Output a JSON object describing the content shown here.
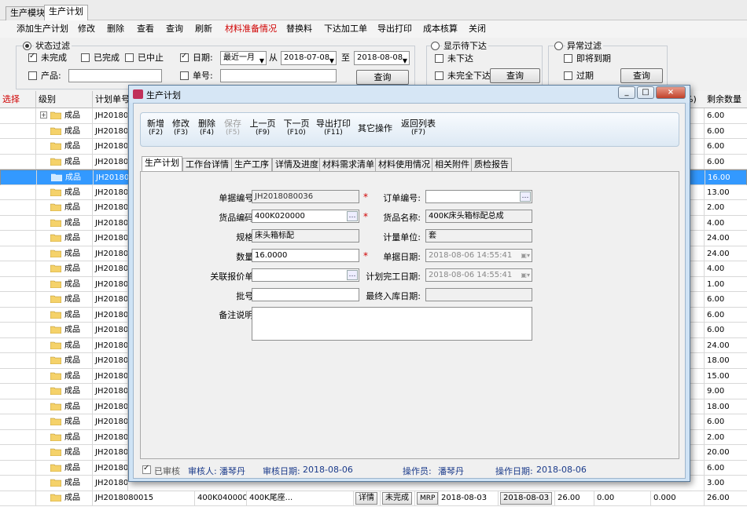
{
  "tabs": [
    "生产模块",
    "生产计划"
  ],
  "toolbar": [
    "添加生产计划",
    "修改",
    "删除",
    "查看",
    "查询",
    "刷新",
    "材料准备情况",
    "替换料",
    "下达加工单",
    "导出打印",
    "成本核算",
    "关闭"
  ],
  "filter": {
    "status_label": "状态过滤",
    "incomplete": "未完成",
    "complete": "已完成",
    "stopped": "已中止",
    "date_label": "日期:",
    "date_range": "最近一月",
    "from": "从",
    "date_from": "2018-07-08",
    "to": "至",
    "date_to": "2018-08-08",
    "product_label": "产品:",
    "doc_label": "单号:",
    "query": "查询",
    "show_pending": "显示待下达",
    "not_issued": "未下达",
    "partial_issued": "未完全下达",
    "abnormal": "异常过滤",
    "due_soon": "即将到期",
    "overdue": "过期"
  },
  "grid": {
    "headers": [
      "选择",
      "级别",
      "计划单号",
      "",
      "剩余数量"
    ],
    "percent_suffix": "%)",
    "category": "成品",
    "rows": [
      {
        "id": "JH201808",
        "rem": "6.00"
      },
      {
        "id": "JH201808",
        "rem": "6.00"
      },
      {
        "id": "JH201808",
        "rem": "6.00"
      },
      {
        "id": "JH201808",
        "rem": "6.00"
      },
      {
        "id": "JH201808",
        "rem": "16.00"
      },
      {
        "id": "JH201808",
        "rem": "13.00"
      },
      {
        "id": "JH201808",
        "rem": "2.00"
      },
      {
        "id": "JH201808",
        "rem": "4.00"
      },
      {
        "id": "JH201808",
        "rem": "24.00"
      },
      {
        "id": "JH201808",
        "rem": "24.00"
      },
      {
        "id": "JH201808",
        "rem": "4.00"
      },
      {
        "id": "JH201808",
        "rem": "1.00"
      },
      {
        "id": "JH201808",
        "rem": "6.00"
      },
      {
        "id": "JH201808",
        "rem": "6.00"
      },
      {
        "id": "JH201808",
        "rem": "6.00"
      },
      {
        "id": "JH201808",
        "rem": "24.00"
      },
      {
        "id": "JH201808",
        "rem": "18.00"
      },
      {
        "id": "JH201808",
        "rem": "15.00"
      },
      {
        "id": "JH201808",
        "rem": "9.00"
      },
      {
        "id": "JH201808",
        "rem": "18.00"
      },
      {
        "id": "JH201808",
        "rem": "6.00"
      },
      {
        "id": "JH201808",
        "rem": "2.00"
      },
      {
        "id": "JH201808",
        "rem": "20.00"
      },
      {
        "id": "JH201808",
        "rem": "6.00"
      },
      {
        "id": "JH201808",
        "rem": "3.00"
      }
    ],
    "last_row": {
      "id": "JH2018080015",
      "code": "400K040000",
      "name": "400K尾座...",
      "detail": "详情",
      "status": "未完成",
      "mrp": "MRP",
      "date1": "2018-08-03",
      "date2": "2018-08-03",
      "qty": "26.00",
      "v1": "0.00",
      "v2": "0.000",
      "rem": "26.00"
    }
  },
  "modal": {
    "title": "生产计划",
    "tools": [
      {
        "label": "新增",
        "key": "(F2)"
      },
      {
        "label": "修改",
        "key": "(F3)"
      },
      {
        "label": "删除",
        "key": "(F4)"
      },
      {
        "label": "保存",
        "key": "(F5)",
        "disabled": true
      },
      {
        "label": "上一页",
        "key": "(F9)"
      },
      {
        "label": "下一页",
        "key": "(F10)"
      },
      {
        "label": "导出打印",
        "key": "(F11)"
      },
      {
        "label": "其它操作",
        "key": ""
      },
      {
        "label": "返回列表",
        "key": "(F7)"
      }
    ],
    "tabs": [
      "生产计划",
      "工作台详情",
      "生产工序",
      "详情及进度",
      "材料需求清单",
      "材料使用情况",
      "相关附件",
      "质检报告"
    ],
    "form": {
      "doc_no_label": "单据编号:",
      "doc_no": "JH2018080036",
      "order_no_label": "订单编号:",
      "order_no": "",
      "item_code_label": "货品编码:",
      "item_code": "400K020000",
      "item_name_label": "货品名称:",
      "item_name": "400K床头箱标配总成",
      "spec_label": "规格:",
      "spec": "床头箱标配",
      "unit_label": "计量单位:",
      "unit": "套",
      "qty_label": "数量:",
      "qty": "16.0000",
      "doc_date_label": "单据日期:",
      "doc_date": "2018-08-06  14:55:41",
      "quote_label": "关联报价单:",
      "quote": "",
      "plan_date_label": "计划完工日期:",
      "plan_date": "2018-08-06  14:55:41",
      "batch_label": "批号:",
      "batch": "",
      "final_date_label": "最终入库日期:",
      "final_date": "",
      "remark_label": "备注说明:",
      "remark": ""
    },
    "footer": {
      "approved": "已审核",
      "approver_label": "审核人:",
      "approver": "潘琴丹",
      "approve_date_label": "审核日期:",
      "approve_date": "2018-08-06",
      "operator_label": "操作员:",
      "operator": "潘琴丹",
      "op_date_label": "操作日期:",
      "op_date": "2018-08-06"
    }
  }
}
